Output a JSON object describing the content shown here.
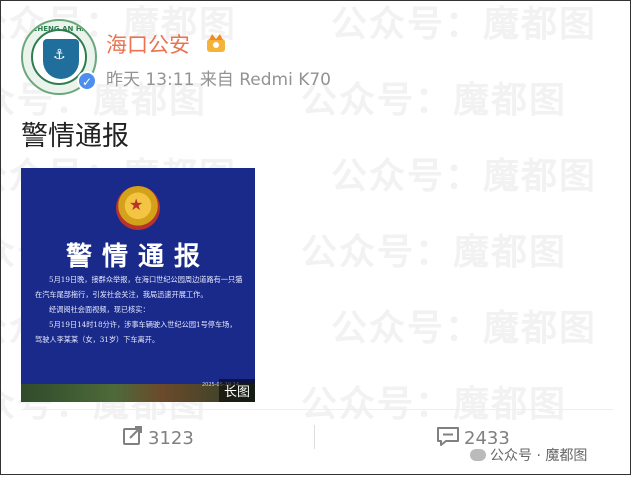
{
  "user": {
    "name": "海口公安",
    "avatar_text": "CHENG AN HAI KOU",
    "verified": true
  },
  "post": {
    "timestamp": "昨天 13:11",
    "source": "来自 Redmi K70",
    "text": "警情通报"
  },
  "image": {
    "title": "警情通报",
    "body": [
      "5月19日晚，接群众举报，在海口世纪公园周边道路有一只猫在汽车尾部拖行，引发社会关注，我局迅速开展工作。",
      "经调阅社会面视频，现已核实：",
      "5月19日14时18分许，涉事车辆驶入世纪公园1号停车场，驾驶人李某某（女，31岁）下车离开。"
    ],
    "date": "2025-05-19 14",
    "long_tag": "长图"
  },
  "actions": {
    "repost_count": "3123",
    "comment_count": "2433"
  },
  "watermark": {
    "text": "公众号：魔都图",
    "corner": "公众号 · 魔都图"
  },
  "colors": {
    "username": "#eb7350",
    "poster_bg": "#1a2a8a",
    "verified_badge": "#4d8ef0"
  }
}
